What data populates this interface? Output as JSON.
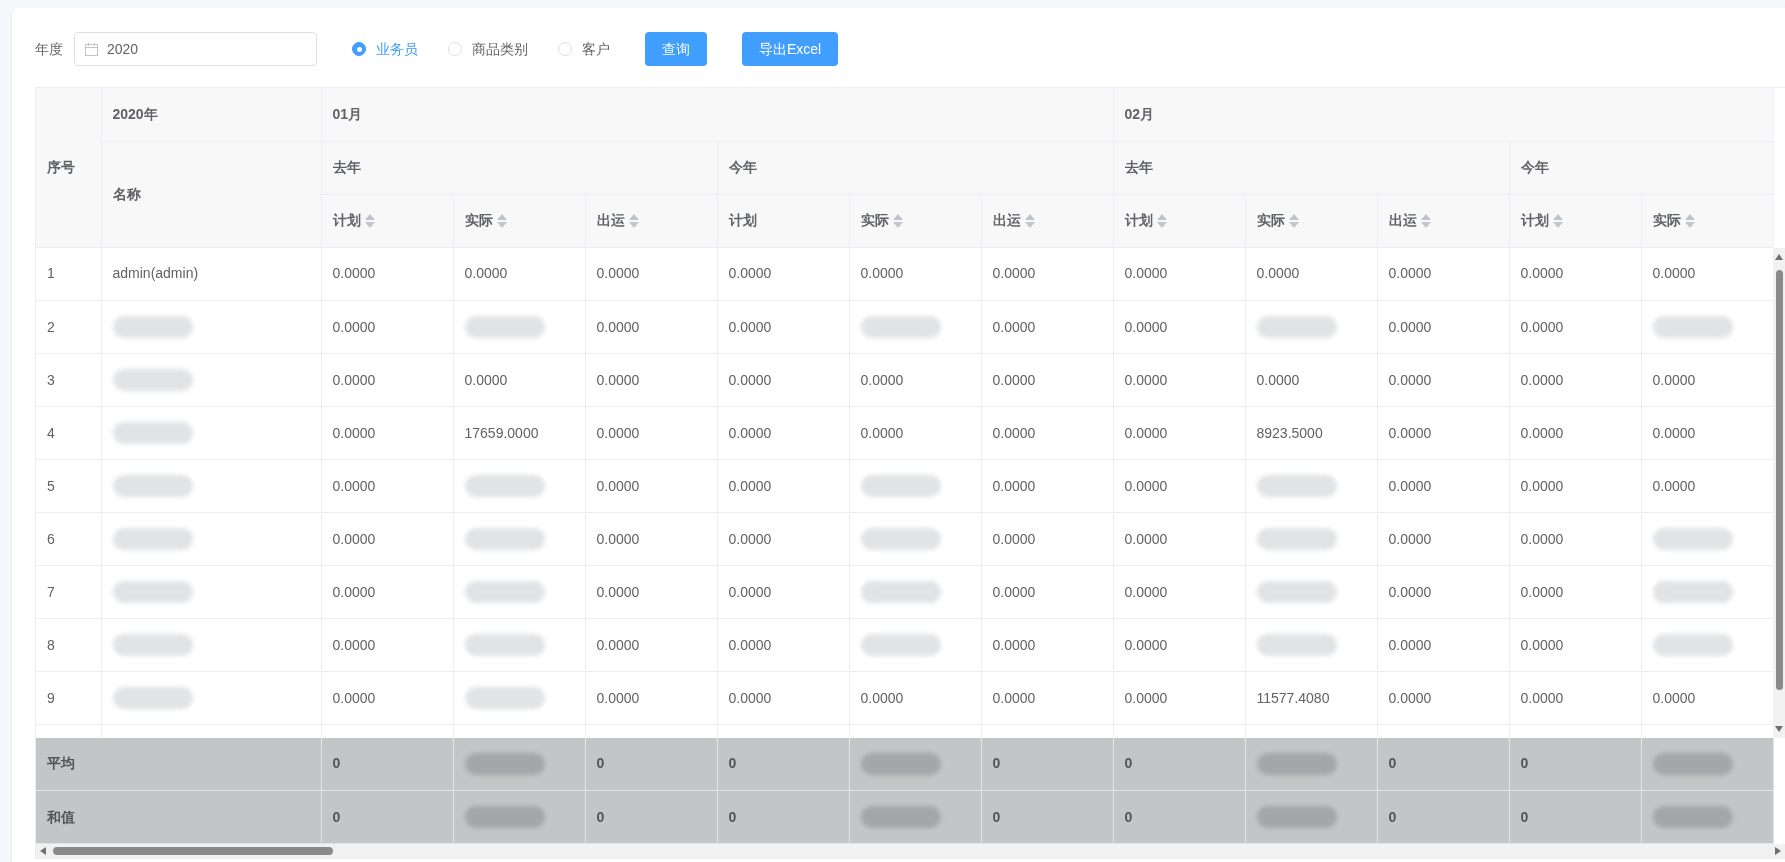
{
  "toolbar": {
    "year_label": "年度",
    "year_field": {
      "value": "2020"
    },
    "radios": [
      {
        "label": "业务员",
        "selected": true
      },
      {
        "label": "商品类别",
        "selected": false
      },
      {
        "label": "客户",
        "selected": false
      }
    ],
    "buttons": [
      "查询",
      "导出Excel"
    ]
  },
  "table": {
    "index_header": "序号",
    "year_header": "2020年",
    "name_header": "名称",
    "months": [
      {
        "label": "01月",
        "groups": [
          {
            "label": "去年",
            "columns": [
              {
                "label": "计划",
                "sortable": true
              },
              {
                "label": "实际",
                "sortable": true
              },
              {
                "label": "出运",
                "sortable": true
              }
            ]
          },
          {
            "label": "今年",
            "columns": [
              {
                "label": "计划",
                "sortable": false
              },
              {
                "label": "实际",
                "sortable": true
              },
              {
                "label": "出运",
                "sortable": true
              }
            ]
          }
        ]
      },
      {
        "label": "02月",
        "groups": [
          {
            "label": "去年",
            "columns": [
              {
                "label": "计划",
                "sortable": true
              },
              {
                "label": "实际",
                "sortable": true
              },
              {
                "label": "出运",
                "sortable": true
              }
            ]
          },
          {
            "label": "今年",
            "columns": [
              {
                "label": "计划",
                "sortable": true
              },
              {
                "label": "实际",
                "sortable": true
              }
            ]
          }
        ]
      }
    ],
    "rows": [
      {
        "index": "1",
        "name": {
          "kind": "text",
          "text": "admin(admin)"
        },
        "values": [
          {
            "kind": "text",
            "text": "0.0000"
          },
          {
            "kind": "text",
            "text": "0.0000"
          },
          {
            "kind": "text",
            "text": "0.0000"
          },
          {
            "kind": "text",
            "text": "0.0000"
          },
          {
            "kind": "text",
            "text": "0.0000"
          },
          {
            "kind": "text",
            "text": "0.0000"
          },
          {
            "kind": "text",
            "text": "0.0000"
          },
          {
            "kind": "text",
            "text": "0.0000"
          },
          {
            "kind": "text",
            "text": "0.0000"
          },
          {
            "kind": "text",
            "text": "0.0000"
          },
          {
            "kind": "text",
            "text": "0.0000"
          }
        ]
      },
      {
        "index": "2",
        "name": {
          "kind": "redacted"
        },
        "values": [
          {
            "kind": "text",
            "text": "0.0000"
          },
          {
            "kind": "redacted"
          },
          {
            "kind": "text",
            "text": "0.0000"
          },
          {
            "kind": "text",
            "text": "0.0000"
          },
          {
            "kind": "redacted"
          },
          {
            "kind": "text",
            "text": "0.0000"
          },
          {
            "kind": "text",
            "text": "0.0000"
          },
          {
            "kind": "redacted"
          },
          {
            "kind": "text",
            "text": "0.0000"
          },
          {
            "kind": "text",
            "text": "0.0000"
          },
          {
            "kind": "redacted"
          }
        ]
      },
      {
        "index": "3",
        "name": {
          "kind": "redacted"
        },
        "values": [
          {
            "kind": "text",
            "text": "0.0000"
          },
          {
            "kind": "text",
            "text": "0.0000"
          },
          {
            "kind": "text",
            "text": "0.0000"
          },
          {
            "kind": "text",
            "text": "0.0000"
          },
          {
            "kind": "text",
            "text": "0.0000"
          },
          {
            "kind": "text",
            "text": "0.0000"
          },
          {
            "kind": "text",
            "text": "0.0000"
          },
          {
            "kind": "text",
            "text": "0.0000"
          },
          {
            "kind": "text",
            "text": "0.0000"
          },
          {
            "kind": "text",
            "text": "0.0000"
          },
          {
            "kind": "text",
            "text": "0.0000"
          }
        ]
      },
      {
        "index": "4",
        "name": {
          "kind": "redacted"
        },
        "values": [
          {
            "kind": "text",
            "text": "0.0000"
          },
          {
            "kind": "text",
            "text": "17659.0000"
          },
          {
            "kind": "text",
            "text": "0.0000"
          },
          {
            "kind": "text",
            "text": "0.0000"
          },
          {
            "kind": "text",
            "text": "0.0000"
          },
          {
            "kind": "text",
            "text": "0.0000"
          },
          {
            "kind": "text",
            "text": "0.0000"
          },
          {
            "kind": "text",
            "text": "8923.5000"
          },
          {
            "kind": "text",
            "text": "0.0000"
          },
          {
            "kind": "text",
            "text": "0.0000"
          },
          {
            "kind": "text",
            "text": "0.0000"
          }
        ]
      },
      {
        "index": "5",
        "name": {
          "kind": "redacted"
        },
        "values": [
          {
            "kind": "text",
            "text": "0.0000"
          },
          {
            "kind": "redacted"
          },
          {
            "kind": "text",
            "text": "0.0000"
          },
          {
            "kind": "text",
            "text": "0.0000"
          },
          {
            "kind": "redacted"
          },
          {
            "kind": "text",
            "text": "0.0000"
          },
          {
            "kind": "text",
            "text": "0.0000"
          },
          {
            "kind": "redacted"
          },
          {
            "kind": "text",
            "text": "0.0000"
          },
          {
            "kind": "text",
            "text": "0.0000"
          },
          {
            "kind": "text",
            "text": "0.0000"
          }
        ]
      },
      {
        "index": "6",
        "name": {
          "kind": "redacted"
        },
        "values": [
          {
            "kind": "text",
            "text": "0.0000"
          },
          {
            "kind": "redacted"
          },
          {
            "kind": "text",
            "text": "0.0000"
          },
          {
            "kind": "text",
            "text": "0.0000"
          },
          {
            "kind": "redacted"
          },
          {
            "kind": "text",
            "text": "0.0000"
          },
          {
            "kind": "text",
            "text": "0.0000"
          },
          {
            "kind": "redacted"
          },
          {
            "kind": "text",
            "text": "0.0000"
          },
          {
            "kind": "text",
            "text": "0.0000"
          },
          {
            "kind": "redacted"
          }
        ]
      },
      {
        "index": "7",
        "name": {
          "kind": "redacted"
        },
        "values": [
          {
            "kind": "text",
            "text": "0.0000"
          },
          {
            "kind": "redacted"
          },
          {
            "kind": "text",
            "text": "0.0000"
          },
          {
            "kind": "text",
            "text": "0.0000"
          },
          {
            "kind": "redacted"
          },
          {
            "kind": "text",
            "text": "0.0000"
          },
          {
            "kind": "text",
            "text": "0.0000"
          },
          {
            "kind": "redacted"
          },
          {
            "kind": "text",
            "text": "0.0000"
          },
          {
            "kind": "text",
            "text": "0.0000"
          },
          {
            "kind": "redacted"
          }
        ]
      },
      {
        "index": "8",
        "name": {
          "kind": "redacted"
        },
        "values": [
          {
            "kind": "text",
            "text": "0.0000"
          },
          {
            "kind": "redacted"
          },
          {
            "kind": "text",
            "text": "0.0000"
          },
          {
            "kind": "text",
            "text": "0.0000"
          },
          {
            "kind": "redacted"
          },
          {
            "kind": "text",
            "text": "0.0000"
          },
          {
            "kind": "text",
            "text": "0.0000"
          },
          {
            "kind": "redacted"
          },
          {
            "kind": "text",
            "text": "0.0000"
          },
          {
            "kind": "text",
            "text": "0.0000"
          },
          {
            "kind": "redacted"
          }
        ]
      },
      {
        "index": "9",
        "name": {
          "kind": "redacted"
        },
        "values": [
          {
            "kind": "text",
            "text": "0.0000"
          },
          {
            "kind": "redacted"
          },
          {
            "kind": "text",
            "text": "0.0000"
          },
          {
            "kind": "text",
            "text": "0.0000"
          },
          {
            "kind": "text",
            "text": "0.0000"
          },
          {
            "kind": "text",
            "text": "0.0000"
          },
          {
            "kind": "text",
            "text": "0.0000"
          },
          {
            "kind": "text",
            "text": "11577.4080"
          },
          {
            "kind": "text",
            "text": "0.0000"
          },
          {
            "kind": "text",
            "text": "0.0000"
          },
          {
            "kind": "text",
            "text": "0.0000"
          }
        ]
      }
    ],
    "summary": [
      {
        "label": "平均",
        "values": [
          {
            "kind": "text",
            "text": "0"
          },
          {
            "kind": "redacted"
          },
          {
            "kind": "text",
            "text": "0"
          },
          {
            "kind": "text",
            "text": "0"
          },
          {
            "kind": "redacted"
          },
          {
            "kind": "text",
            "text": "0"
          },
          {
            "kind": "text",
            "text": "0"
          },
          {
            "kind": "redacted"
          },
          {
            "kind": "text",
            "text": "0"
          },
          {
            "kind": "text",
            "text": "0"
          },
          {
            "kind": "redacted"
          }
        ]
      },
      {
        "label": "和值",
        "values": [
          {
            "kind": "text",
            "text": "0"
          },
          {
            "kind": "redacted"
          },
          {
            "kind": "text",
            "text": "0"
          },
          {
            "kind": "text",
            "text": "0"
          },
          {
            "kind": "redacted"
          },
          {
            "kind": "text",
            "text": "0"
          },
          {
            "kind": "text",
            "text": "0"
          },
          {
            "kind": "redacted"
          },
          {
            "kind": "text",
            "text": "0"
          },
          {
            "kind": "text",
            "text": "0"
          },
          {
            "kind": "redacted"
          }
        ]
      }
    ]
  }
}
